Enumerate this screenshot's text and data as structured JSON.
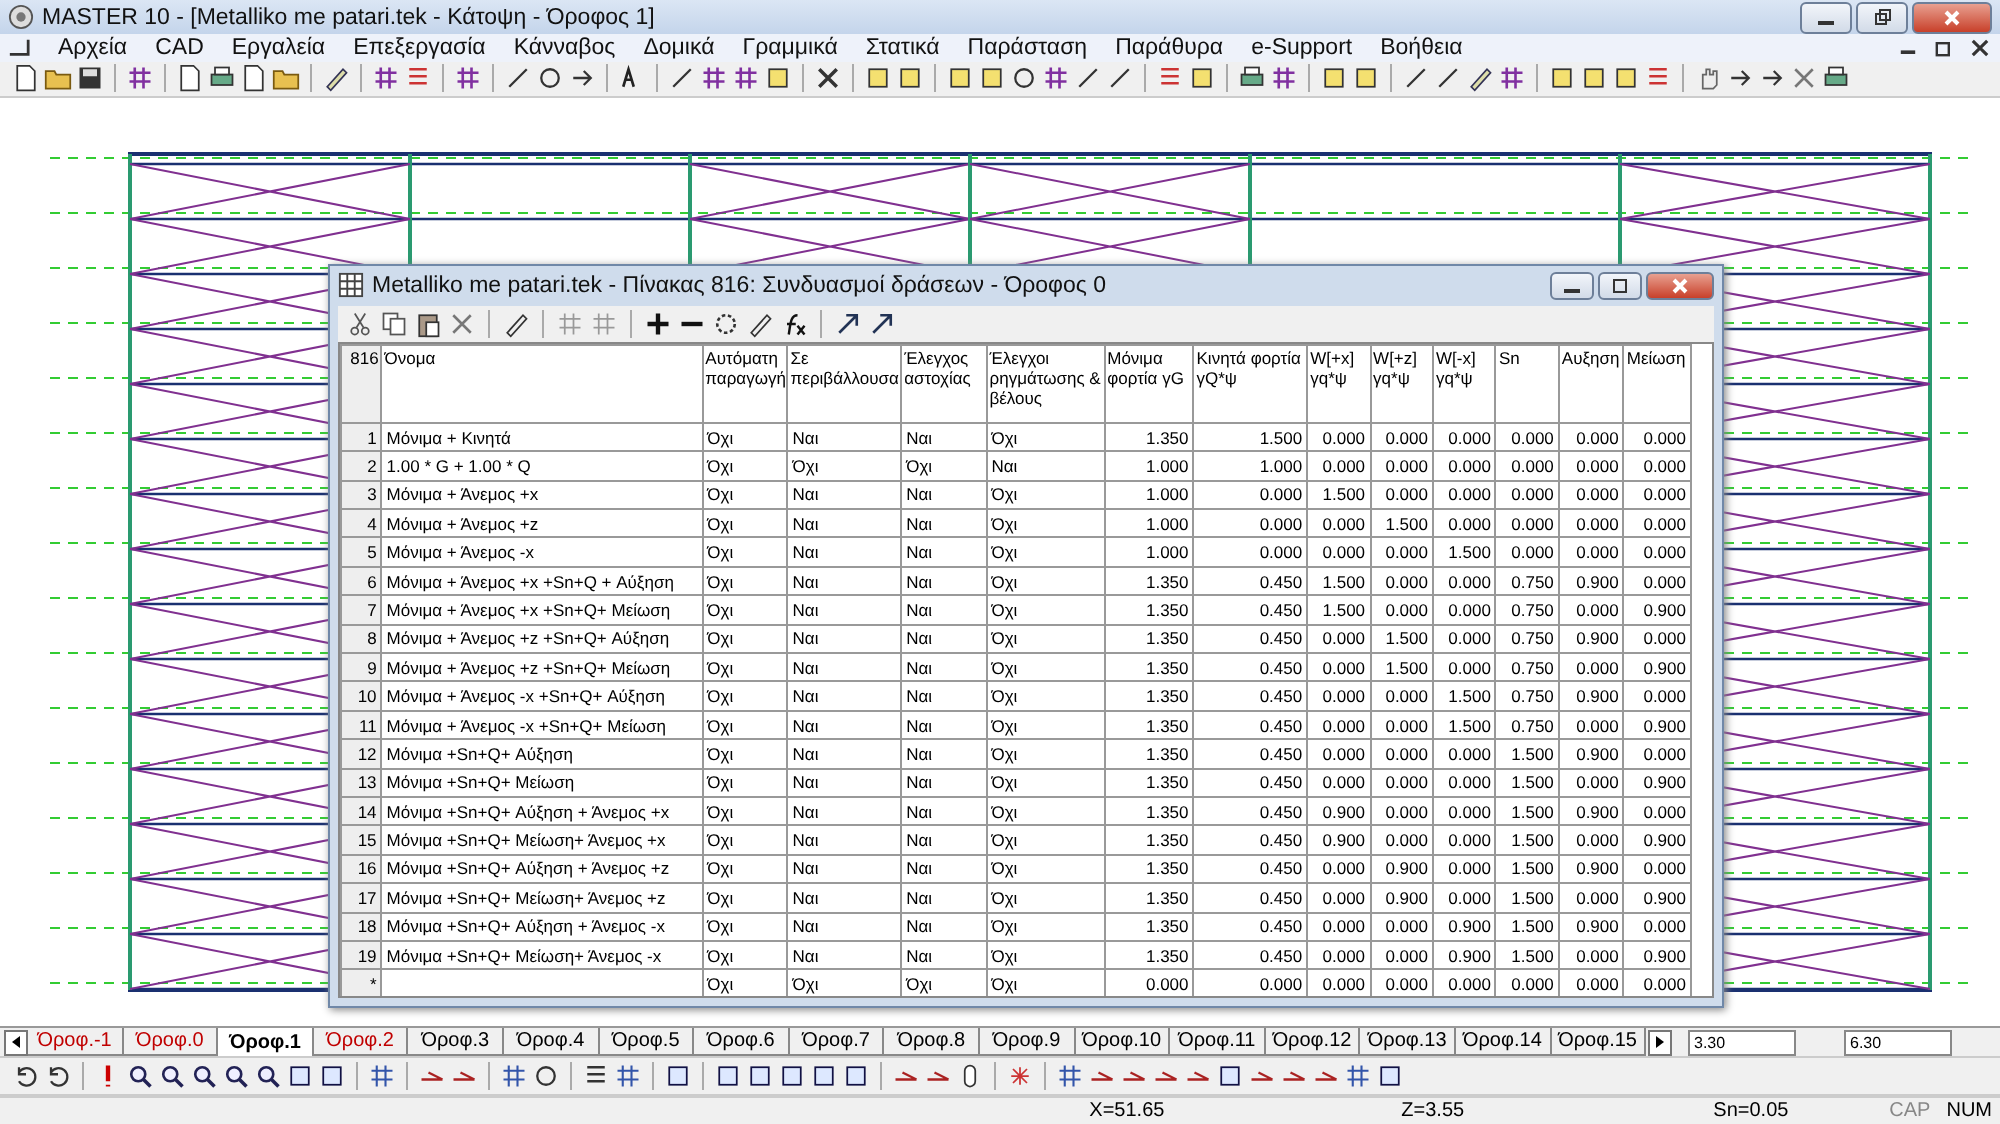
{
  "window": {
    "title": "MASTER 10 - [Metalliko me patari.tek - Κάτοψη - Όροφος 1]"
  },
  "menu": [
    "Αρχεία",
    "CAD",
    "Εργαλεία",
    "Επεξεργασία",
    "Κάνναβος",
    "Δομικά",
    "Γραμμικά",
    "Στατικά",
    "Παράσταση",
    "Παράθυρα",
    "e-Support",
    "Βοήθεια"
  ],
  "dialog": {
    "title": "Metalliko me patari.tek - Πίνακας 816: Συνδυασμοί δράσεων - Όροφος 0",
    "corner": "816",
    "columns": [
      "Όνομα",
      "Αυτόματη παραγωγή",
      "Σε περιβάλλουσα",
      "Έλεγχος αστοχίας",
      "Έλεγχοι ρηγμάτωσης & βέλους",
      "Μόνιμα φορτία γG",
      "Κινητά φορτία γQ*ψ",
      "W[+x] γq*ψ",
      "W[+z] γq*ψ",
      "W[-x] γq*ψ",
      "Sn",
      "Αυξηση",
      "Μείωση"
    ],
    "rows": [
      {
        "number": "1",
        "cells": [
          "Μόνιμα + Κινητά",
          "Όχι",
          "Ναι",
          "Ναι",
          "Όχι",
          "1.350",
          "1.500",
          "0.000",
          "0.000",
          "0.000",
          "0.000",
          "0.000",
          "0.000"
        ]
      },
      {
        "number": "2",
        "cells": [
          "1.00 * G + 1.00 * Q",
          "Όχι",
          "Όχι",
          "Όχι",
          "Ναι",
          "1.000",
          "1.000",
          "0.000",
          "0.000",
          "0.000",
          "0.000",
          "0.000",
          "0.000"
        ]
      },
      {
        "number": "3",
        "cells": [
          "Μόνιμα + Άνεμος +x",
          "Όχι",
          "Ναι",
          "Ναι",
          "Όχι",
          "1.000",
          "0.000",
          "1.500",
          "0.000",
          "0.000",
          "0.000",
          "0.000",
          "0.000"
        ]
      },
      {
        "number": "4",
        "cells": [
          "Μόνιμα + Άνεμος +z",
          "Όχι",
          "Ναι",
          "Ναι",
          "Όχι",
          "1.000",
          "0.000",
          "0.000",
          "1.500",
          "0.000",
          "0.000",
          "0.000",
          "0.000"
        ]
      },
      {
        "number": "5",
        "cells": [
          "Μόνιμα + Άνεμος -x",
          "Όχι",
          "Ναι",
          "Ναι",
          "Όχι",
          "1.000",
          "0.000",
          "0.000",
          "0.000",
          "1.500",
          "0.000",
          "0.000",
          "0.000"
        ]
      },
      {
        "number": "6",
        "cells": [
          "Μόνιμα + Άνεμος +x +Sn+Q + Αύξηση",
          "Όχι",
          "Ναι",
          "Ναι",
          "Όχι",
          "1.350",
          "0.450",
          "1.500",
          "0.000",
          "0.000",
          "0.750",
          "0.900",
          "0.000"
        ]
      },
      {
        "number": "7",
        "cells": [
          "Μόνιμα + Άνεμος +x +Sn+Q+ Μείωση",
          "Όχι",
          "Ναι",
          "Ναι",
          "Όχι",
          "1.350",
          "0.450",
          "1.500",
          "0.000",
          "0.000",
          "0.750",
          "0.000",
          "0.900"
        ]
      },
      {
        "number": "8",
        "cells": [
          "Μόνιμα + Άνεμος +z +Sn+Q+ Αύξηση",
          "Όχι",
          "Ναι",
          "Ναι",
          "Όχι",
          "1.350",
          "0.450",
          "0.000",
          "1.500",
          "0.000",
          "0.750",
          "0.900",
          "0.000"
        ]
      },
      {
        "number": "9",
        "cells": [
          "Μόνιμα + Άνεμος +z +Sn+Q+ Μείωση",
          "Όχι",
          "Ναι",
          "Ναι",
          "Όχι",
          "1.350",
          "0.450",
          "0.000",
          "1.500",
          "0.000",
          "0.750",
          "0.000",
          "0.900"
        ]
      },
      {
        "number": "10",
        "cells": [
          "Μόνιμα + Άνεμος -x +Sn+Q+ Αύξηση",
          "Όχι",
          "Ναι",
          "Ναι",
          "Όχι",
          "1.350",
          "0.450",
          "0.000",
          "0.000",
          "1.500",
          "0.750",
          "0.900",
          "0.000"
        ]
      },
      {
        "number": "11",
        "cells": [
          "Μόνιμα + Άνεμος -x +Sn+Q+ Μείωση",
          "Όχι",
          "Ναι",
          "Ναι",
          "Όχι",
          "1.350",
          "0.450",
          "0.000",
          "0.000",
          "1.500",
          "0.750",
          "0.000",
          "0.900"
        ]
      },
      {
        "number": "12",
        "cells": [
          "Μόνιμα +Sn+Q+ Αύξηση",
          "Όχι",
          "Ναι",
          "Ναι",
          "Όχι",
          "1.350",
          "0.450",
          "0.000",
          "0.000",
          "0.000",
          "1.500",
          "0.900",
          "0.000"
        ]
      },
      {
        "number": "13",
        "cells": [
          "Μόνιμα +Sn+Q+ Μείωση",
          "Όχι",
          "Ναι",
          "Ναι",
          "Όχι",
          "1.350",
          "0.450",
          "0.000",
          "0.000",
          "0.000",
          "1.500",
          "0.000",
          "0.900"
        ]
      },
      {
        "number": "14",
        "cells": [
          "Μόνιμα +Sn+Q+ Αύξηση + Άνεμος +x",
          "Όχι",
          "Ναι",
          "Ναι",
          "Όχι",
          "1.350",
          "0.450",
          "0.900",
          "0.000",
          "0.000",
          "1.500",
          "0.900",
          "0.000"
        ]
      },
      {
        "number": "15",
        "cells": [
          "Μόνιμα +Sn+Q+ Μείωση+ Άνεμος +x",
          "Όχι",
          "Ναι",
          "Ναι",
          "Όχι",
          "1.350",
          "0.450",
          "0.900",
          "0.000",
          "0.000",
          "1.500",
          "0.000",
          "0.900"
        ]
      },
      {
        "number": "16",
        "cells": [
          "Μόνιμα +Sn+Q+ Αύξηση + Άνεμος +z",
          "Όχι",
          "Ναι",
          "Ναι",
          "Όχι",
          "1.350",
          "0.450",
          "0.000",
          "0.900",
          "0.000",
          "1.500",
          "0.900",
          "0.000"
        ]
      },
      {
        "number": "17",
        "cells": [
          "Μόνιμα +Sn+Q+ Μείωση+ Άνεμος +z",
          "Όχι",
          "Ναι",
          "Ναι",
          "Όχι",
          "1.350",
          "0.450",
          "0.000",
          "0.900",
          "0.000",
          "1.500",
          "0.000",
          "0.900"
        ]
      },
      {
        "number": "18",
        "cells": [
          "Μόνιμα +Sn+Q+ Αύξηση + Άνεμος -x",
          "Όχι",
          "Ναι",
          "Ναι",
          "Όχι",
          "1.350",
          "0.450",
          "0.000",
          "0.000",
          "0.900",
          "1.500",
          "0.900",
          "0.000"
        ]
      },
      {
        "number": "19",
        "cells": [
          "Μόνιμα +Sn+Q+ Μείωση+ Άνεμος -x",
          "Όχι",
          "Ναι",
          "Ναι",
          "Όχι",
          "1.350",
          "0.450",
          "0.000",
          "0.000",
          "0.900",
          "1.500",
          "0.000",
          "0.900"
        ]
      },
      {
        "number": "*",
        "cells": [
          "",
          "Όχι",
          "Όχι",
          "Όχι",
          "Όχι",
          "0.000",
          "0.000",
          "0.000",
          "0.000",
          "0.000",
          "0.000",
          "0.000",
          "0.000"
        ]
      }
    ]
  },
  "floor_tabs": [
    {
      "label": "Όροφ.-1",
      "selected": false,
      "color": "#c00000"
    },
    {
      "label": "Όροφ.0",
      "selected": false,
      "color": "#c00000"
    },
    {
      "label": "Όροφ.1",
      "selected": true,
      "color": "#000000"
    },
    {
      "label": "Όροφ.2",
      "selected": false,
      "color": "#c00000"
    },
    {
      "label": "Όροφ.3",
      "selected": false,
      "color": "#000000"
    },
    {
      "label": "Όροφ.4",
      "selected": false,
      "color": "#000000"
    },
    {
      "label": "Όροφ.5",
      "selected": false,
      "color": "#000000"
    },
    {
      "label": "Όροφ.6",
      "selected": false,
      "color": "#000000"
    },
    {
      "label": "Όροφ.7",
      "selected": false,
      "color": "#000000"
    },
    {
      "label": "Όροφ.8",
      "selected": false,
      "color": "#000000"
    },
    {
      "label": "Όροφ.9",
      "selected": false,
      "color": "#000000"
    },
    {
      "label": "Όροφ.10",
      "selected": false,
      "color": "#000000"
    },
    {
      "label": "Όροφ.11",
      "selected": false,
      "color": "#000000"
    },
    {
      "label": "Όροφ.12",
      "selected": false,
      "color": "#000000"
    },
    {
      "label": "Όροφ.13",
      "selected": false,
      "color": "#000000"
    },
    {
      "label": "Όροφ.14",
      "selected": false,
      "color": "#000000"
    },
    {
      "label": "Όροφ.15",
      "selected": false,
      "color": "#000000"
    }
  ],
  "coordinate_fields": [
    "3.30",
    "6.30"
  ],
  "status_bar": {
    "x": "X=51.65",
    "z": "Z=3.55",
    "sn": "Sn=0.05",
    "indicators": [
      "CAP",
      "NUM"
    ]
  }
}
